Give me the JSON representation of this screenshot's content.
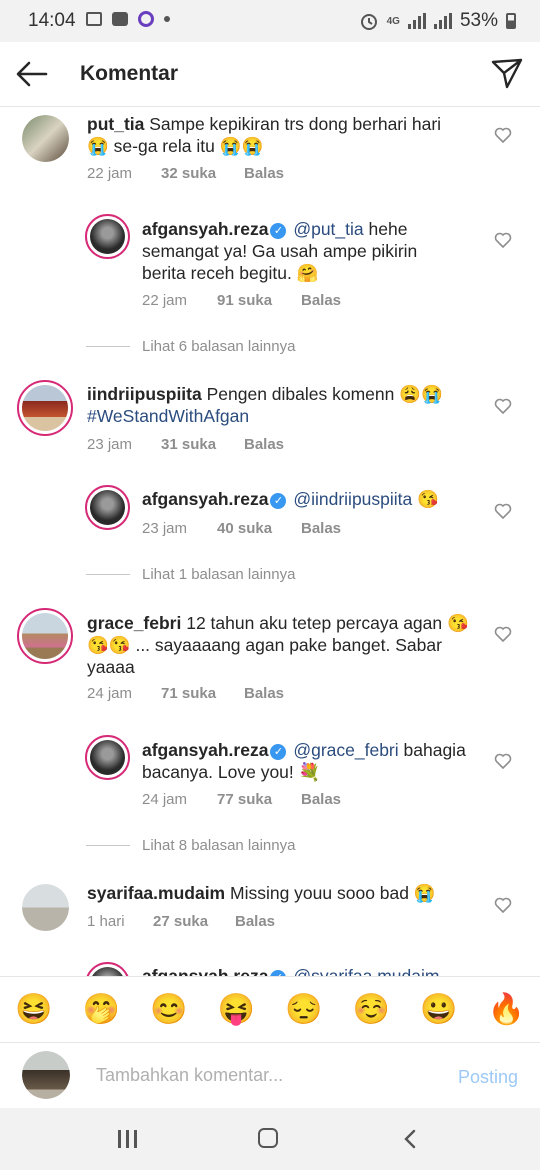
{
  "status_bar": {
    "time": "14:04",
    "battery": "53%",
    "network": "4G"
  },
  "header": {
    "title": "Komentar",
    "back_icon": "arrow-left-icon",
    "send_icon": "paper-plane-icon"
  },
  "comments": [
    {
      "user": "put_tia",
      "text": "Sampe kepikiran trs dong berhari hari",
      "text2": "se-ga rela itu",
      "emoji1": "😭",
      "emoji2": "😭😭",
      "time": "22 jam",
      "likes": "32 suka",
      "reply": "Balas"
    },
    {
      "user": "afgansyah.reza",
      "mention": "@put_tia",
      "text": " hehe",
      "text2": "semangat ya! Ga usah ampe pikirin",
      "text3": "berita receh begitu.",
      "emoji": "🤗",
      "time": "22 jam",
      "likes": "91 suka",
      "reply": "Balas"
    },
    {
      "more": "Lihat 6 balasan lainnya"
    },
    {
      "user": "iindriipuspiita",
      "text": "Pengen dibales komenn",
      "emoji": "😩😭",
      "hashtag": "#WeStandWithAfgan",
      "time": "23 jam",
      "likes": "31 suka",
      "reply": "Balas"
    },
    {
      "user": "afgansyah.reza",
      "mention": "@iindriipuspiita",
      "emoji": "😘",
      "time": "23 jam",
      "likes": "40 suka",
      "reply": "Balas"
    },
    {
      "more": "Lihat 1 balasan lainnya"
    },
    {
      "user": "grace_febri",
      "text": "12 tahun aku tetep percaya agan",
      "emoji1": "😘",
      "emoji2": "😘😘",
      "text2": " ... sayaaaang agan pake banget. Sabar",
      "text3": "yaaaa",
      "time": "24 jam",
      "likes": "71 suka",
      "reply": "Balas"
    },
    {
      "user": "afgansyah.reza",
      "mention": "@grace_febri",
      "text": " bahagia",
      "text2": "bacanya. Love you!",
      "emoji": "💐",
      "time": "24 jam",
      "likes": "77 suka",
      "reply": "Balas"
    },
    {
      "more": "Lihat 8 balasan lainnya"
    },
    {
      "user": "syarifaa.mudaim",
      "text": "Missing youu sooo bad",
      "emoji": "😭",
      "time": "1 hari",
      "likes": "27 suka",
      "reply": "Balas"
    },
    {
      "user": "afgansyah.reza",
      "mention": "@syarifaa.mudaim"
    }
  ],
  "emoji_bar": [
    "😆",
    "🤭",
    "😊",
    "😝",
    "😔",
    "☺️",
    "😀",
    "🔥"
  ],
  "composer": {
    "placeholder": "Tambahkan komentar...",
    "post_label": "Posting"
  },
  "colors": {
    "link": "#2b4c7e",
    "verified": "#3897f0",
    "post_disabled": "#9cc9f5",
    "ring": "#d62976"
  }
}
